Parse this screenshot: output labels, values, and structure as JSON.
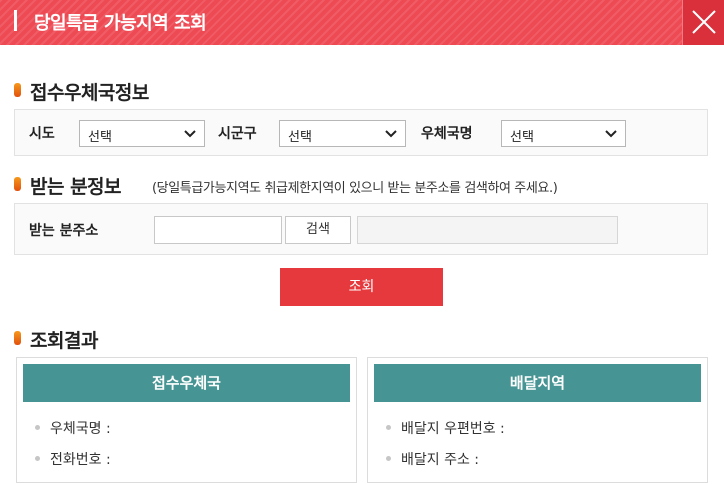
{
  "header": {
    "title": "당일특급 가능지역 조회"
  },
  "section_sender": {
    "title": "접수우체국정보",
    "sido_label": "시도",
    "sido_value": "선택",
    "sigungu_label": "시군구",
    "sigungu_value": "선택",
    "office_label": "우체국명",
    "office_value": "선택"
  },
  "section_receiver": {
    "title": "받는 분정보",
    "note": "(당일특급가능지역도 취급제한지역이 있으니 받는 분주소를 검색하여 주세요.)",
    "address_label": "받는 분주소",
    "address_value": "",
    "search_button": "검색",
    "result_value": ""
  },
  "query_button": "조회",
  "section_result": {
    "title": "조회결과",
    "left_card": {
      "heading": "접수우체국",
      "rows": [
        "우체국명 :",
        "전화번호 :"
      ]
    },
    "right_card": {
      "heading": "배달지역",
      "rows": [
        "배달지 우편번호 :",
        "배달지 주소 :"
      ]
    }
  },
  "colors": {
    "header": "#ee4a54",
    "query_button": "#e6393d",
    "card_heading": "#469493",
    "section_marker": "#f07a16"
  },
  "icons": [
    "close-icon",
    "chevron-down-icon",
    "bullet-icon"
  ]
}
